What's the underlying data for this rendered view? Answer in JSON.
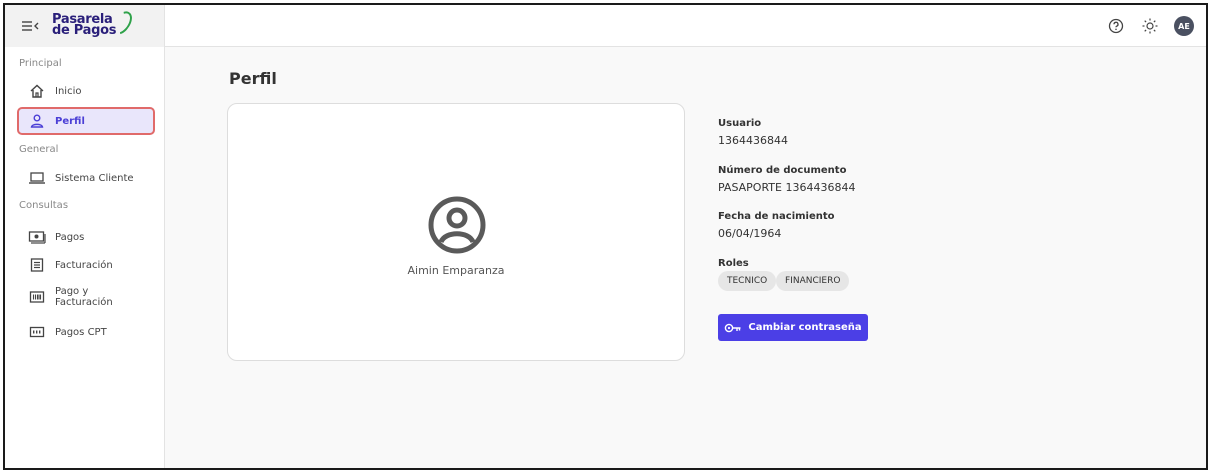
{
  "brand": {
    "line1": "Pasarela",
    "line2": "de Pagos"
  },
  "user": {
    "initials": "AE"
  },
  "sidebar": {
    "sections": [
      {
        "title": "Principal"
      },
      {
        "title": "General"
      },
      {
        "title": "Consultas"
      }
    ],
    "items": [
      {
        "label": "Inicio",
        "icon": "home-icon"
      },
      {
        "label": "Perfil",
        "icon": "user-icon",
        "active": true
      },
      {
        "label": "Sistema Cliente",
        "icon": "laptop-icon"
      },
      {
        "label": "Pagos",
        "icon": "cash-icon"
      },
      {
        "label": "Facturación",
        "icon": "receipt-icon"
      },
      {
        "label_line1": "Pago y",
        "label_line2": "Facturación",
        "icon": "barcode-icon"
      },
      {
        "label": "Pagos CPT",
        "icon": "number-pad-icon"
      }
    ]
  },
  "main": {
    "title": "Perfil",
    "profile": {
      "name": "Aimin Emparanza"
    },
    "details": {
      "usuario_label": "Usuario",
      "usuario_value": "1364436844",
      "documento_label": "Número de documento",
      "documento_value": "PASAPORTE 1364436844",
      "nacimiento_label": "Fecha de nacimiento",
      "nacimiento_value": "06/04/1964",
      "roles_label": "Roles",
      "roles": [
        "TECNICO",
        "FINANCIERO"
      ]
    },
    "change_password_label": "Cambiar contraseña"
  },
  "colors": {
    "accent": "#4b3fe6",
    "brand_text": "#2a1f7a",
    "brand_arc": "#2fa24a",
    "highlight": "#e06a6a"
  }
}
